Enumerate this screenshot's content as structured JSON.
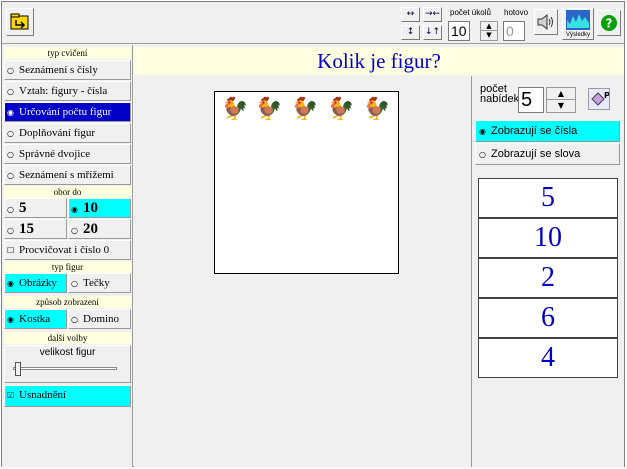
{
  "toolbar": {
    "task_count_label": "počet úkolů",
    "task_count_value": "10",
    "done_label": "hotovo",
    "done_value": "0",
    "results_label": "Výsledky",
    "arrow_icons": [
      "↔",
      "→←",
      "↕",
      "↓↑"
    ]
  },
  "left": {
    "exercise_type": {
      "title": "typ cvičení",
      "items": [
        {
          "label": "Seznámení s čísly",
          "selected": false
        },
        {
          "label": "Vztah: figury - čísla",
          "selected": false
        },
        {
          "label": "Určování počtu figur",
          "selected": true
        },
        {
          "label": "Doplňování figur",
          "selected": false
        },
        {
          "label": "Správné dvojice",
          "selected": false
        },
        {
          "label": "Seznámení s mřížemi",
          "selected": false
        }
      ]
    },
    "range": {
      "title": "obor do",
      "items": [
        {
          "label": "5",
          "selected": false
        },
        {
          "label": "10",
          "selected": true
        },
        {
          "label": "15",
          "selected": false
        },
        {
          "label": "20",
          "selected": false
        }
      ],
      "practice_zero": "Procvičovat i číslo 0"
    },
    "figure_type": {
      "title": "typ figur",
      "items": [
        {
          "label": "Obrázky",
          "selected": true
        },
        {
          "label": "Tečky",
          "selected": false
        }
      ]
    },
    "display_mode": {
      "title": "způsob zobrazení",
      "items": [
        {
          "label": "Kostka",
          "selected": true
        },
        {
          "label": "Domino",
          "selected": false
        }
      ]
    },
    "other": {
      "title": "další volby",
      "figure_size_label": "velikost figur",
      "figure_size_level": 0,
      "easing": "Usnadnění",
      "easing_checked": true
    }
  },
  "main": {
    "title": "Kolik je figur?",
    "figure_count": 5,
    "figure_icon": "rooster-icon",
    "offers_label_1": "počet",
    "offers_label_2": "nabídek",
    "offers_value": "5",
    "show_numbers": "Zobrazují se čísla",
    "show_words": "Zobrazují se slova",
    "answers": [
      "5",
      "10",
      "2",
      "6",
      "4"
    ]
  },
  "colors": {
    "accent_blue": "#0000c8",
    "highlight_cyan": "#00ffff",
    "header_yellow": "#ffffe1"
  }
}
